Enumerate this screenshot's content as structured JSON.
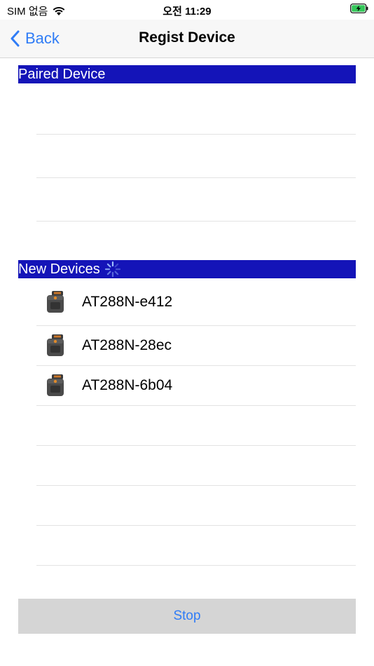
{
  "status_bar": {
    "carrier": "SIM 없음",
    "time": "오전 11:29",
    "icons": [
      "wifi-icon",
      "battery-charging-icon"
    ]
  },
  "nav": {
    "back_label": "Back",
    "title": "Regist Device"
  },
  "paired_section": {
    "title": "Paired Device",
    "devices": []
  },
  "new_section": {
    "title": "New Devices",
    "loading": true,
    "devices": [
      {
        "name": "AT288N-e412",
        "icon": "scanner-device-icon"
      },
      {
        "name": "AT288N-28ec",
        "icon": "scanner-device-icon"
      },
      {
        "name": "AT288N-6b04",
        "icon": "scanner-device-icon"
      }
    ]
  },
  "actions": {
    "stop_label": "Stop"
  },
  "colors": {
    "section_header_bg": "#1414b8",
    "accent": "#2f7cf6",
    "stop_button_bg": "#d5d5d5",
    "battery_green": "#34c759"
  }
}
